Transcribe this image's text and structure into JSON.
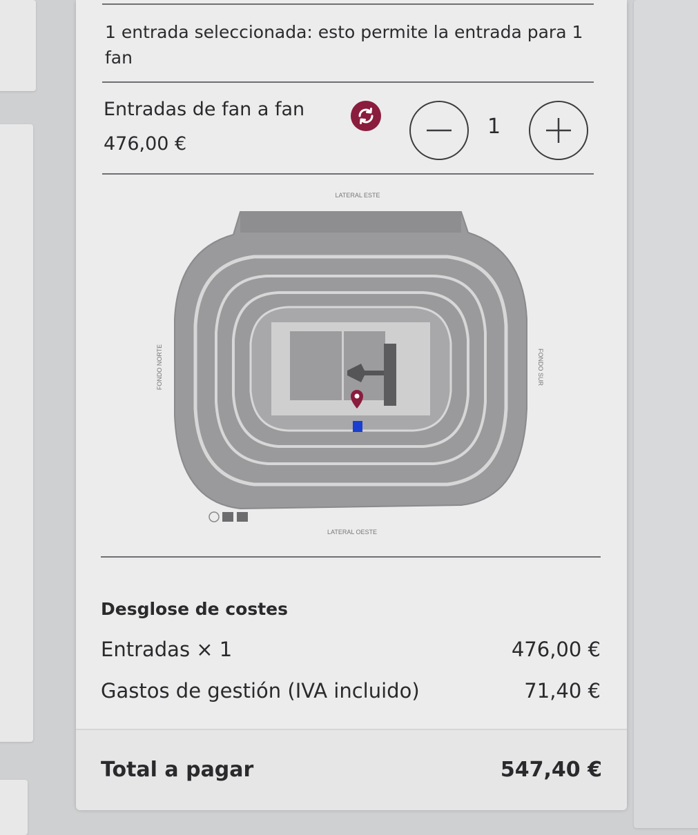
{
  "selection": {
    "message": "1 entrada seleccionada: esto permite la entrada para 1 fan"
  },
  "ticket": {
    "name": "Entradas de fan a fan",
    "price": "476,00 €",
    "quantity": "1",
    "resale_icon": "refresh-arrows-icon",
    "decrement_icon": "minus-icon",
    "increment_icon": "plus-icon",
    "accent_color": "#8a1c3e"
  },
  "stadium_map": {
    "label_top": "LATERAL ESTE",
    "label_bottom": "LATERAL OESTE",
    "label_left": "FONDO NORTE",
    "label_right": "FONDO SUR",
    "marker_icon": "map-pin-icon",
    "selected_seat_color": "#1a3fd0"
  },
  "breakdown": {
    "title": "Desglose de costes",
    "rows": [
      {
        "label": "Entradas × 1",
        "value": "476,00 €"
      },
      {
        "label": "Gastos de gestión (IVA incluido)",
        "value": "71,40 €"
      }
    ]
  },
  "total": {
    "label": "Total a pagar",
    "value": "547,40 €"
  }
}
